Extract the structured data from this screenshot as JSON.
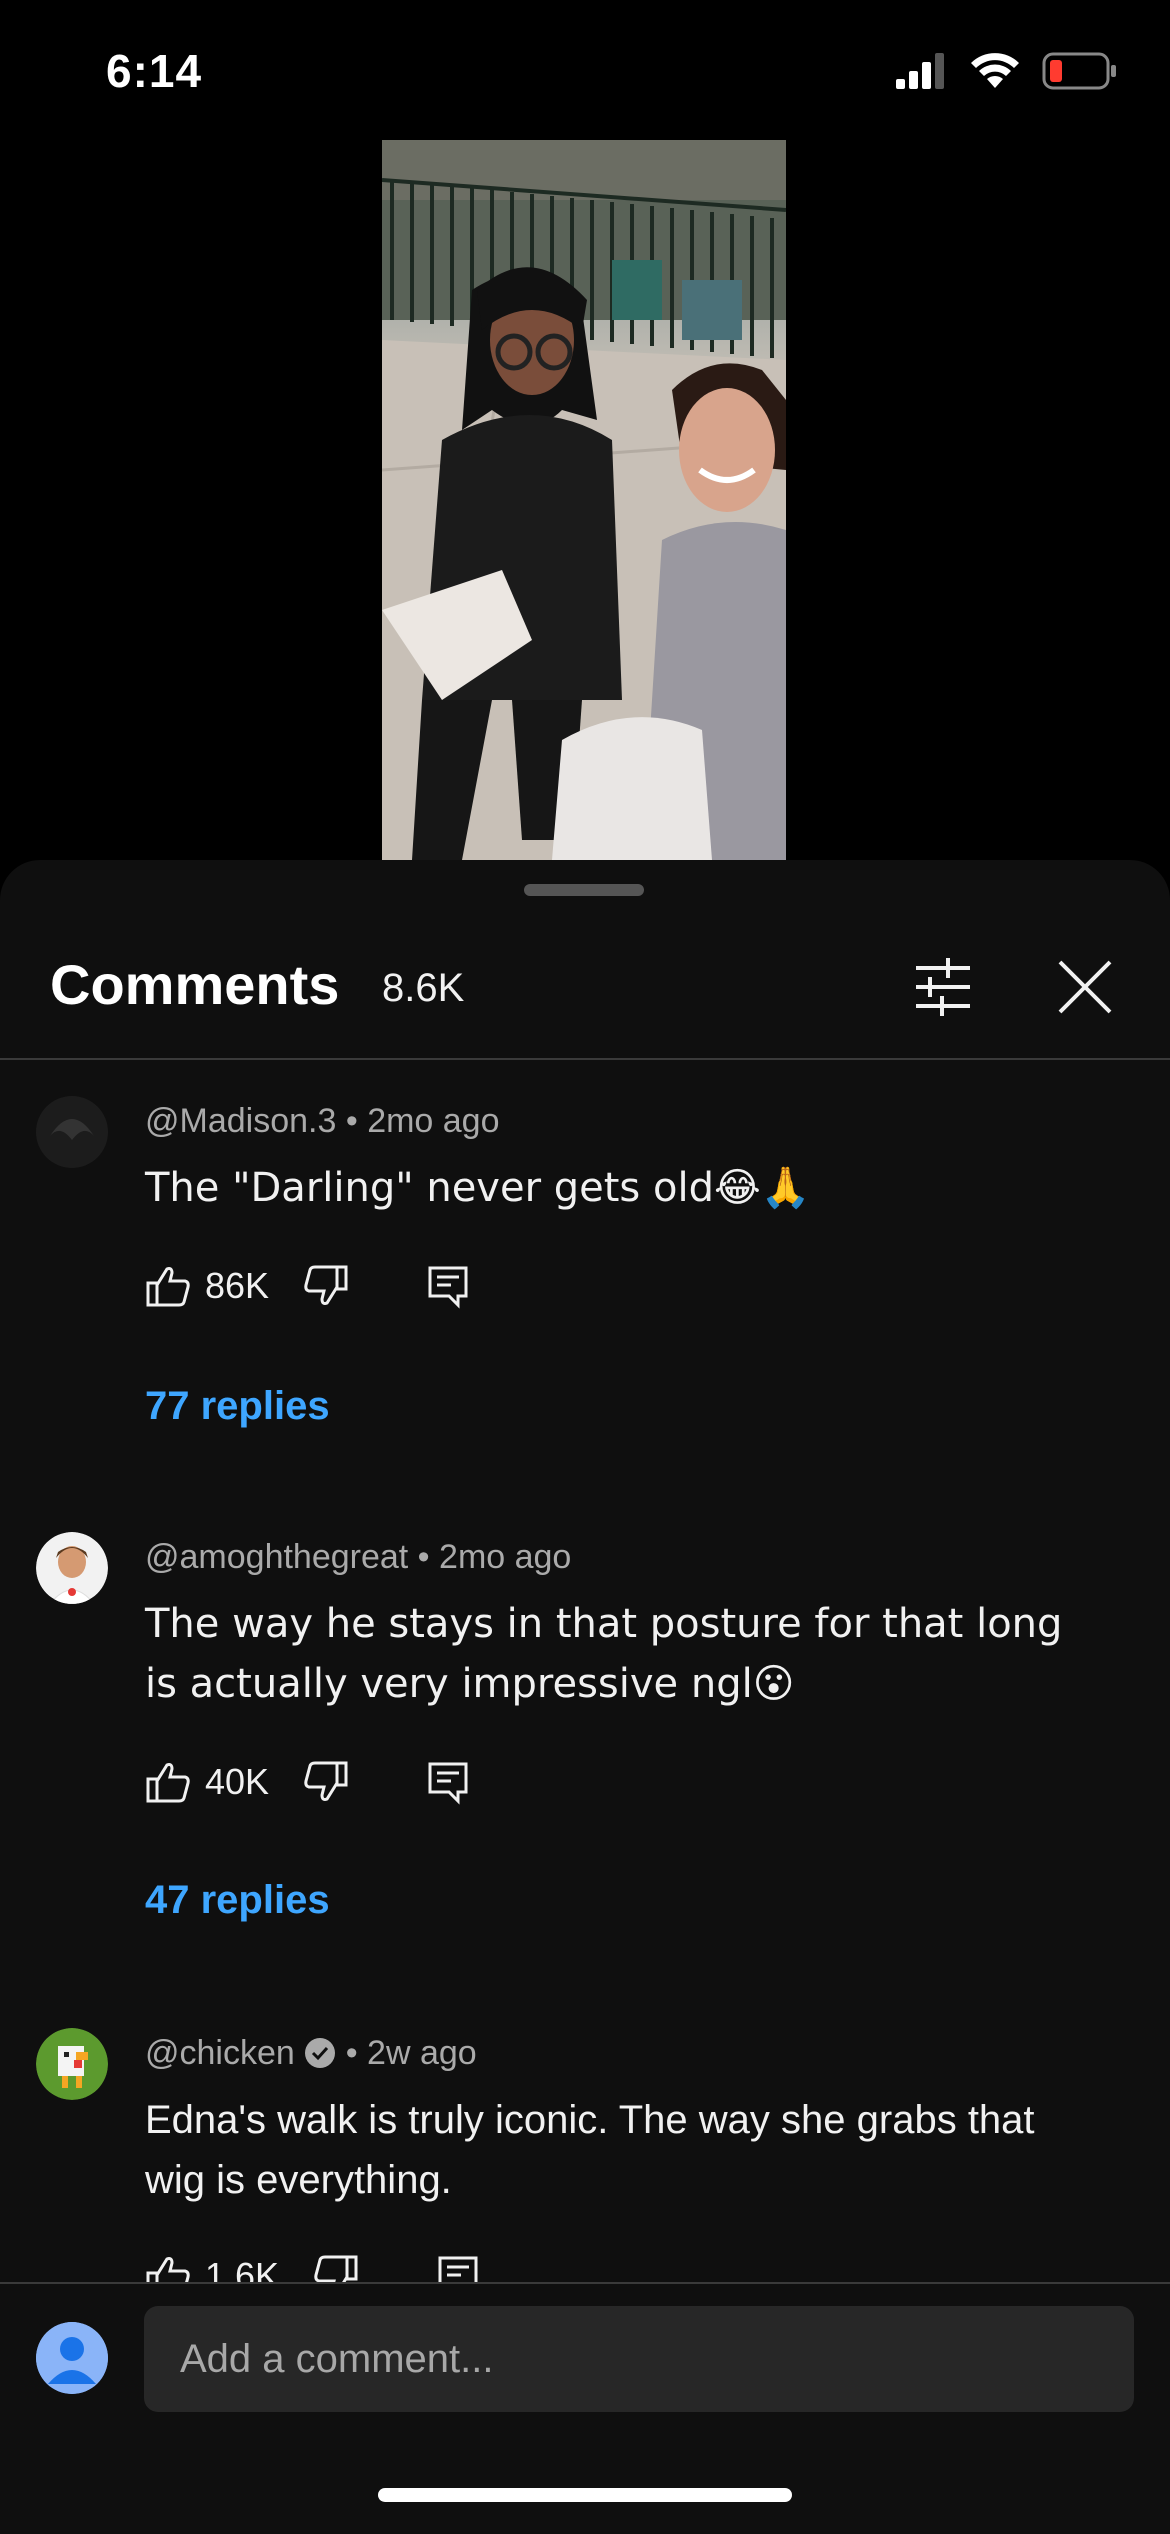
{
  "status_bar": {
    "time": "6:14"
  },
  "sheet": {
    "title": "Comments",
    "count": "8.6K"
  },
  "comments": [
    {
      "author": "@Madison.3",
      "age": "2mo ago",
      "text": "The \"Darling\" never gets old😂🙏",
      "likes": "86K",
      "replies": "77 replies"
    },
    {
      "author": "@amoghthegreat",
      "age": "2mo ago",
      "text": "The way he stays in that posture for that long is actually very impressive ngl😮",
      "likes": "40K",
      "replies": "47 replies"
    },
    {
      "author": "@chicken",
      "age": "2w ago",
      "verified": true,
      "text": "Edna's walk is truly iconic. The way she grabs that wig is everything.",
      "likes": "1.6K"
    }
  ],
  "composer": {
    "placeholder": "Add a comment..."
  },
  "colors": {
    "accent_link": "#3ea6ff",
    "sheet_bg": "#0f0f0f",
    "input_bg": "#272727"
  },
  "icons": [
    "signal-icon",
    "wifi-icon",
    "battery-icon",
    "filter-icon",
    "close-icon",
    "like-icon",
    "dislike-icon",
    "reply-icon",
    "verified-icon"
  ]
}
